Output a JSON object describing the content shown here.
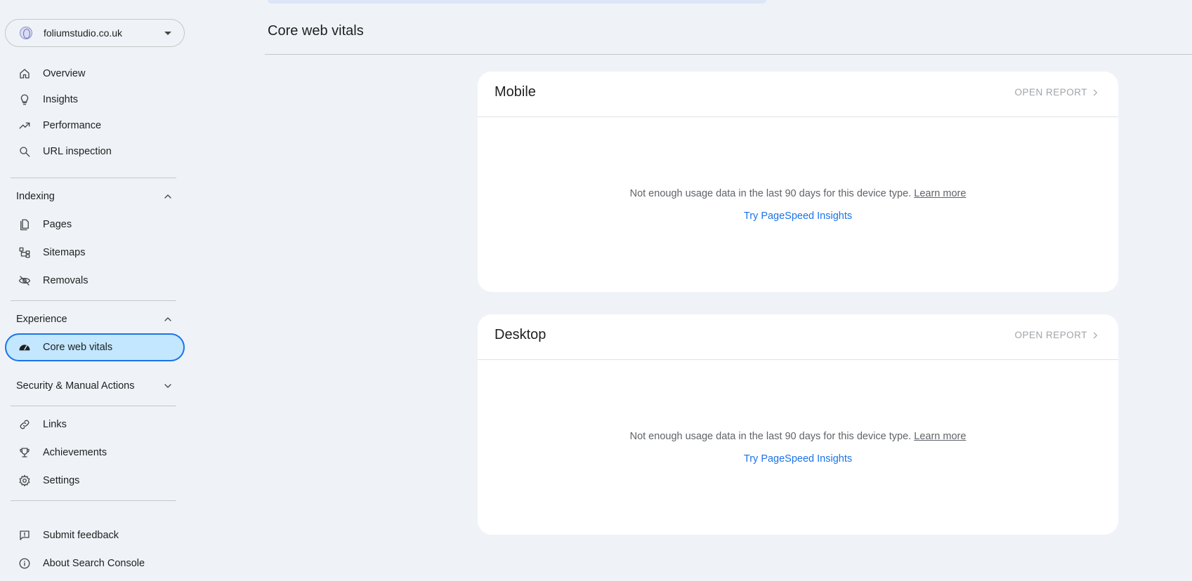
{
  "property": {
    "name": "foliumstudio.co.uk"
  },
  "nav": {
    "top": [
      {
        "label": "Overview",
        "icon": "home-icon"
      },
      {
        "label": "Insights",
        "icon": "lightbulb-icon"
      },
      {
        "label": "Performance",
        "icon": "trending-up-icon"
      },
      {
        "label": "URL inspection",
        "icon": "search-icon"
      }
    ],
    "indexing": {
      "title": "Indexing",
      "items": [
        {
          "label": "Pages",
          "icon": "pages-icon"
        },
        {
          "label": "Sitemaps",
          "icon": "sitemap-icon"
        },
        {
          "label": "Removals",
          "icon": "eye-off-icon"
        }
      ]
    },
    "experience": {
      "title": "Experience",
      "items": [
        {
          "label": "Core web vitals",
          "icon": "speedometer-icon",
          "active": true
        }
      ]
    },
    "security": {
      "title": "Security & Manual Actions"
    },
    "bottom": [
      {
        "label": "Links",
        "icon": "link-icon"
      },
      {
        "label": "Achievements",
        "icon": "trophy-icon"
      },
      {
        "label": "Settings",
        "icon": "gear-icon"
      }
    ],
    "footer": [
      {
        "label": "Submit feedback",
        "icon": "feedback-icon"
      },
      {
        "label": "About Search Console",
        "icon": "info-icon"
      }
    ]
  },
  "main": {
    "title": "Core web vitals",
    "cards": [
      {
        "title": "Mobile",
        "open_report": "OPEN REPORT",
        "message": "Not enough usage data in the last 90 days for this device type.",
        "learn_more": "Learn more",
        "psi_link": "Try PageSpeed Insights"
      },
      {
        "title": "Desktop",
        "open_report": "OPEN REPORT",
        "message": "Not enough usage data in the last 90 days for this device type.",
        "learn_more": "Learn more",
        "psi_link": "Try PageSpeed Insights"
      }
    ]
  },
  "colors": {
    "accent": "#1a73e8",
    "active_bg": "#c2e7ff",
    "page_bg": "#eff3f8"
  }
}
